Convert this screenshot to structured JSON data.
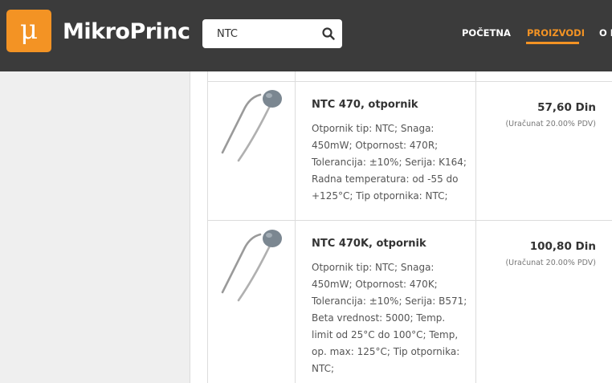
{
  "header": {
    "logo_symbol": "μ",
    "brand": "MikroPrinc",
    "search": {
      "value": "NTC",
      "placeholder": ""
    },
    "nav": [
      {
        "label": "POČETNA",
        "active": false
      },
      {
        "label": "PROIZVODI",
        "active": true
      },
      {
        "label": "O N",
        "active": false
      }
    ],
    "accent_color": "#f39324",
    "bar_color": "#3b3b3b"
  },
  "products": [
    {
      "name": "NTC 470, otpornik",
      "description": "Otpornik tip: NTC; Snaga: 450mW; Otpornost: 470R; Tolerancija: ±10%; Serija: K164; Radna temperatura: od -55 do +125°C; Tip otpornika: NTC;",
      "price": "57,60 Din",
      "vat": "(Uračunat 20.00% PDV)"
    },
    {
      "name": "NTC 470K, otpornik",
      "description": "Otpornik tip: NTC; Snaga: 450mW; Otpornost: 470K; Tolerancija: ±10%; Serija: B571; Beta vrednost: 5000; Temp. limit od 25°C do 100°C; Temp, op. max: 125°C; Tip otpornika: NTC;",
      "price": "100,80 Din",
      "vat": "(Uračunat 20.00% PDV)"
    }
  ]
}
